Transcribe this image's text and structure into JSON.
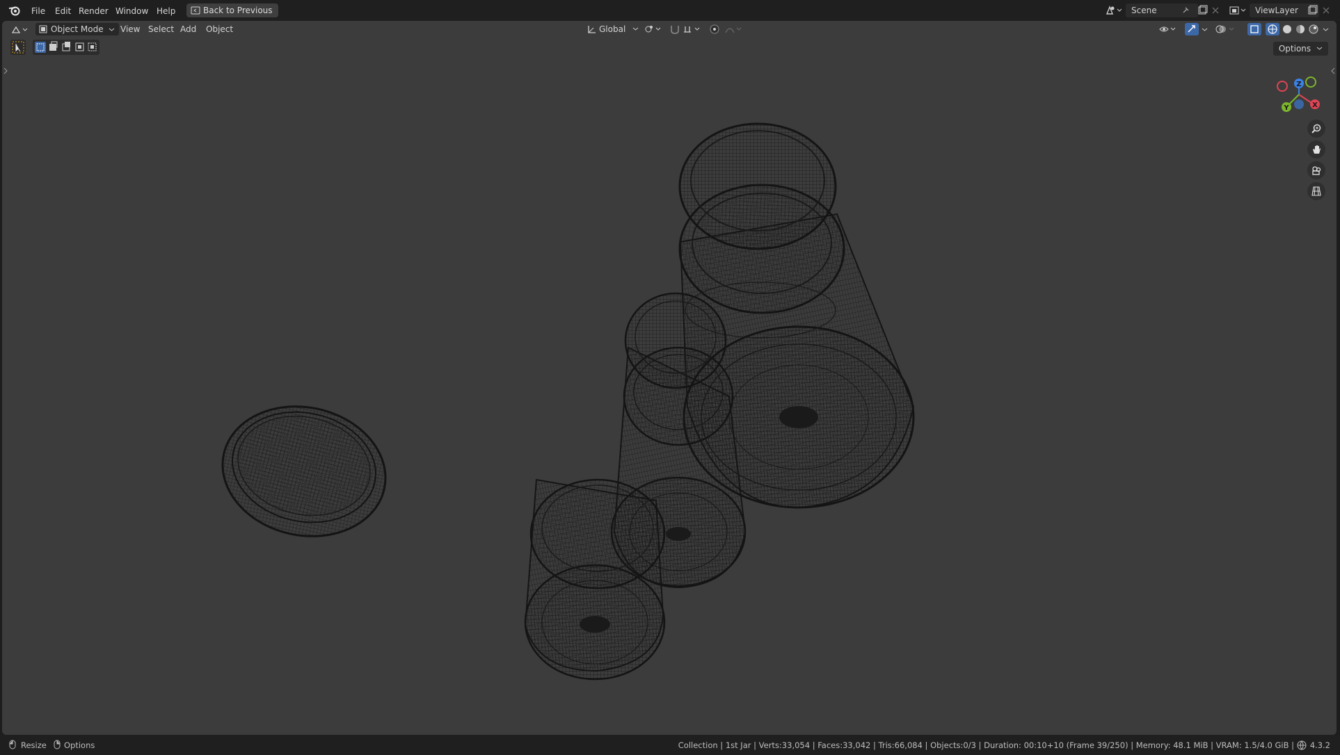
{
  "topbar": {
    "menus": [
      "File",
      "Edit",
      "Render",
      "Window",
      "Help"
    ],
    "back_label": "Back to Previous",
    "scene_name": "Scene",
    "view_layer": "ViewLayer"
  },
  "viewport_header": {
    "mode": "Object Mode",
    "menus": [
      "View",
      "Select",
      "Add",
      "Object"
    ],
    "orientation": "Global",
    "options_label": "Options"
  },
  "gizmo": {
    "x_label": "X",
    "y_label": "Y",
    "z_label": "Z"
  },
  "statusbar": {
    "left_1": "Resize",
    "left_2": "Options",
    "stats": "Collection | 1st Jar | Verts:33,054 | Faces:33,042 | Tris:66,084 | Objects:0/3 | Duration: 00:10+10 (Frame 39/250) | Memory: 48.1 MiB | VRAM: 1.5/4.0 GiB |",
    "version": "4.3.2"
  },
  "colors": {
    "background": "#3c3c3c",
    "wire": "#151515",
    "axis_x": "#e04455",
    "axis_y": "#7cb62c",
    "axis_z": "#3b82e6"
  }
}
